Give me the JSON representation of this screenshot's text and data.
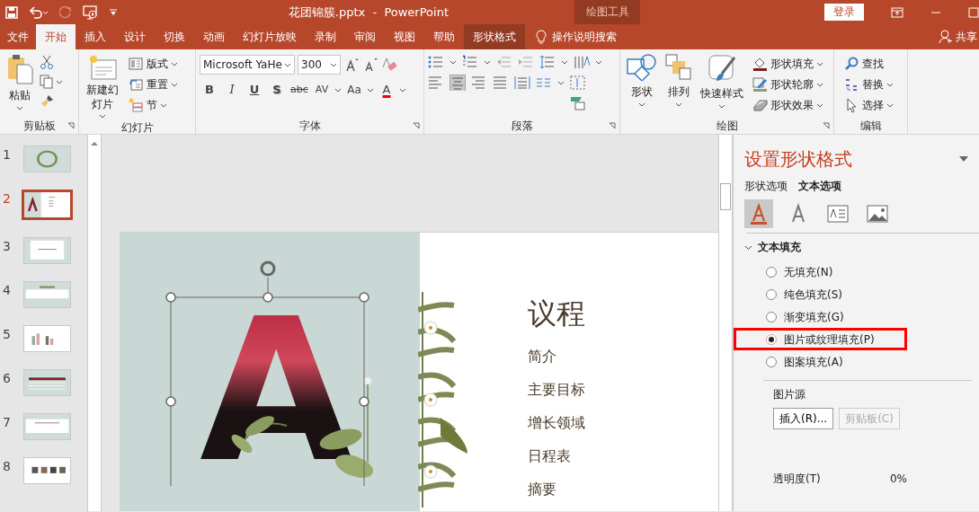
{
  "title_bar": {
    "title": "花团锦簇.pptx  -  PowerPoint",
    "context_label": "绘图工具",
    "sign_in": "登录"
  },
  "tabs": [
    {
      "label": "文件",
      "selected": false,
      "kind": "normal"
    },
    {
      "label": "开始",
      "selected": true,
      "kind": "normal"
    },
    {
      "label": "插入",
      "selected": false,
      "kind": "normal"
    },
    {
      "label": "设计",
      "selected": false,
      "kind": "normal"
    },
    {
      "label": "切换",
      "selected": false,
      "kind": "normal"
    },
    {
      "label": "动画",
      "selected": false,
      "kind": "normal"
    },
    {
      "label": "幻灯片放映",
      "selected": false,
      "kind": "normal"
    },
    {
      "label": "录制",
      "selected": false,
      "kind": "normal"
    },
    {
      "label": "审阅",
      "selected": false,
      "kind": "normal"
    },
    {
      "label": "视图",
      "selected": false,
      "kind": "normal"
    },
    {
      "label": "帮助",
      "selected": false,
      "kind": "normal"
    },
    {
      "label": "形状格式",
      "selected": false,
      "kind": "contextual"
    }
  ],
  "tell_me": "操作说明搜索",
  "share": "共享",
  "ribbon": {
    "groups": [
      {
        "label": "剪贴板",
        "items": [
          {
            "kind": "large",
            "label": "粘贴"
          }
        ]
      },
      {
        "label": "幻灯片",
        "items": [
          {
            "kind": "large",
            "label": "新建幻灯片"
          },
          {
            "kind": "small",
            "label": "版式"
          },
          {
            "kind": "small",
            "label": "重置"
          },
          {
            "kind": "small",
            "label": "节"
          }
        ]
      },
      {
        "label": "字体",
        "font": "Microsoft YaHe",
        "size": "300",
        "items": [
          {
            "kind": "bold",
            "label": "B"
          },
          {
            "kind": "italic",
            "label": "I"
          },
          {
            "kind": "underline",
            "label": "U"
          },
          {
            "kind": "shadow",
            "label": "S"
          },
          {
            "kind": "strike",
            "label": "abc"
          },
          {
            "kind": "spacing",
            "label": "AV"
          },
          {
            "kind": "case",
            "label": "Aa"
          },
          {
            "kind": "color",
            "label": "A"
          }
        ]
      },
      {
        "label": "段落"
      },
      {
        "label": "绘图",
        "items": [
          {
            "kind": "large",
            "label": "形状"
          },
          {
            "kind": "large",
            "label": "排列"
          },
          {
            "kind": "large",
            "label": "快速样式"
          },
          {
            "kind": "small",
            "label": "形状填充"
          },
          {
            "kind": "small",
            "label": "形状轮廓"
          },
          {
            "kind": "small",
            "label": "形状效果"
          }
        ]
      },
      {
        "label": "编辑",
        "items": [
          {
            "kind": "small",
            "label": "查找"
          },
          {
            "kind": "small",
            "label": "替换"
          },
          {
            "kind": "small",
            "label": "选择"
          }
        ]
      }
    ]
  },
  "thumbnails": [
    {
      "number": "1",
      "selected": false
    },
    {
      "number": "2",
      "selected": true
    },
    {
      "number": "3",
      "selected": false
    },
    {
      "number": "4",
      "selected": false
    },
    {
      "number": "5",
      "selected": false
    },
    {
      "number": "6",
      "selected": false
    },
    {
      "number": "7",
      "selected": false
    },
    {
      "number": "8",
      "selected": false
    }
  ],
  "slide": {
    "letter": "A",
    "title": "议程",
    "items": [
      "简介",
      "主要目标",
      "增长领域",
      "日程表",
      "摘要"
    ]
  },
  "pane": {
    "title": "设置形状格式",
    "tabs": [
      {
        "label": "形状选项",
        "selected": false
      },
      {
        "label": "文本选项",
        "selected": true
      }
    ],
    "icon_tabs": [
      {
        "selected": true
      },
      {
        "selected": false
      },
      {
        "selected": false
      },
      {
        "selected": false
      }
    ],
    "section": {
      "label": "文本填充",
      "expanded": true
    },
    "options": [
      {
        "label": "无填充(N)",
        "selected": false,
        "highlighted": false
      },
      {
        "label": "纯色填充(S)",
        "selected": false,
        "highlighted": false
      },
      {
        "label": "渐变填充(G)",
        "selected": false,
        "highlighted": false
      },
      {
        "label": "图片或纹理填充(P)",
        "selected": true,
        "highlighted": true
      },
      {
        "label": "图案填充(A)",
        "selected": false,
        "highlighted": false
      }
    ],
    "source_label": "图片源",
    "buttons": [
      {
        "label": "插入(R)...",
        "disabled": false
      },
      {
        "label": "剪贴板(C)",
        "disabled": true
      }
    ],
    "transparency": {
      "label": "透明度(T)",
      "reading": "0%"
    }
  }
}
